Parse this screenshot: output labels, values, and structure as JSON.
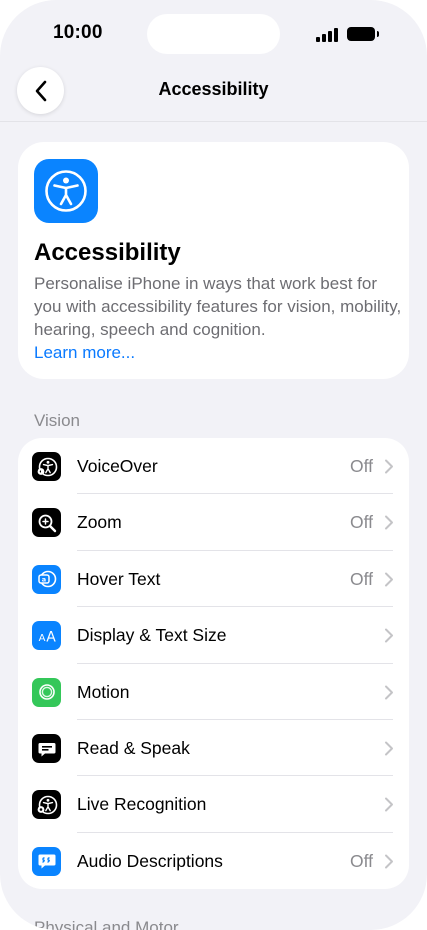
{
  "status": {
    "time": "10:00"
  },
  "nav": {
    "title": "Accessibility",
    "back_icon": "chevron-left-icon"
  },
  "hero": {
    "icon": "accessibility-person-icon",
    "icon_color": "#0A84FF",
    "title": "Accessibility",
    "description": "Personalise iPhone in ways that work best for you with accessibility features for vision, mobility, hearing, speech and cognition.",
    "link": "Learn more..."
  },
  "sections": {
    "vision": "Vision",
    "next": "Physical and Motor"
  },
  "vision_items": [
    {
      "label": "VoiceOver",
      "value": "Off",
      "icon": "voiceover-icon",
      "color": "#000000"
    },
    {
      "label": "Zoom",
      "value": "Off",
      "icon": "zoom-icon",
      "color": "#000000"
    },
    {
      "label": "Hover Text",
      "value": "Off",
      "icon": "hover-text-icon",
      "color": "#0A84FF"
    },
    {
      "label": "Display & Text Size",
      "value": "",
      "icon": "text-size-icon",
      "color": "#0A84FF"
    },
    {
      "label": "Motion",
      "value": "",
      "icon": "motion-icon",
      "color": "#34C759"
    },
    {
      "label": "Read & Speak",
      "value": "",
      "icon": "read-speak-icon",
      "color": "#000000"
    },
    {
      "label": "Live Recognition",
      "value": "",
      "icon": "live-recognition-icon",
      "color": "#000000"
    },
    {
      "label": "Audio Descriptions",
      "value": "Off",
      "icon": "audio-descriptions-icon",
      "color": "#0A84FF"
    }
  ]
}
